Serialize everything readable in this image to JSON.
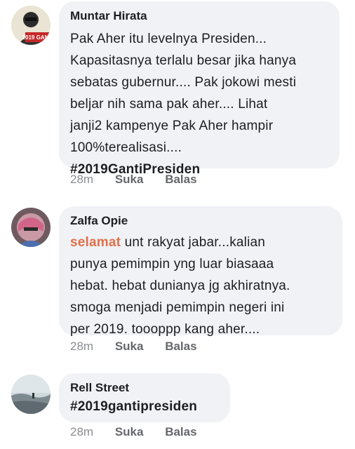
{
  "comments": [
    {
      "author": "Muntar Hirata",
      "text": "Pak Aher itu levelnya Presiden...\nKapasitasnya terlalu besar jika hanya\nsebatas gubernur.... Pak jokowi mesti\nbeljar nih sama pak aher.... Lihat\njanji2 kampenye Pak Aher hampir\n100%terealisasi....",
      "hashtag": "#2019GantiPresiden",
      "avatar_badge": "2019 GANTI",
      "time": "28m",
      "like_label": "Suka",
      "reply_label": "Balas"
    },
    {
      "author": "Zalfa Opie",
      "highlight": "selamat",
      "text_first": " unt rakyat jabar...kalian",
      "text": "punya pemimpin yng luar biasaaa\nhebat. hebat dunianya jg akhiratnya.\nsmoga menjadi pemimpin negeri ini\nper 2019. toooppp kang aher....",
      "time": "28m",
      "like_label": "Suka",
      "reply_label": "Balas"
    },
    {
      "author": "Rell Street",
      "hashtag": "#2019gantipresiden",
      "time": "28m",
      "like_label": "Suka",
      "reply_label": "Balas"
    }
  ],
  "colors": {
    "bubble": "#f0f2f5",
    "meta": "#8a8d91",
    "highlight": "#e0704b"
  }
}
